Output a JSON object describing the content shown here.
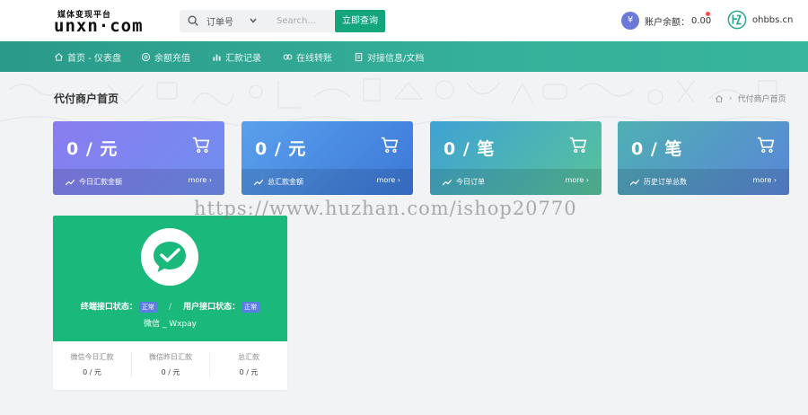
{
  "logo": {
    "sub": "媒体变现平台",
    "main": "unxn·com"
  },
  "search": {
    "select_value": "订单号",
    "placeholder": "Search...",
    "button_label": "立即查询"
  },
  "balance": {
    "icon_glyph": "¥",
    "label": "账户余额：",
    "value": "0.00"
  },
  "brand2": {
    "text": "ohbbs.cn"
  },
  "nav": {
    "items": [
      {
        "label": "首页 - 仪表盘",
        "icon": "home-icon"
      },
      {
        "label": "余额充值",
        "icon": "recharge-icon"
      },
      {
        "label": "汇款记录",
        "icon": "chart-icon"
      },
      {
        "label": "在线转账",
        "icon": "transfer-icon"
      },
      {
        "label": "对接信息/文档",
        "icon": "document-icon"
      }
    ]
  },
  "page": {
    "title": "代付商户首页"
  },
  "breadcrumb": {
    "sep": "›",
    "current": "代付商户首页"
  },
  "cards": [
    {
      "value": "0 / 元",
      "label": "今日汇款金额",
      "more": "more ›",
      "icon": "cart-icon"
    },
    {
      "value": "0 / 元",
      "label": "总汇款金额",
      "more": "more ›",
      "icon": "cart-icon"
    },
    {
      "value": "0 / 笔",
      "label": "今日订单",
      "more": "more ›",
      "icon": "cart-icon"
    },
    {
      "value": "0 / 笔",
      "label": "历史订单总数",
      "more": "more ›",
      "icon": "cart-icon"
    }
  ],
  "pay_card": {
    "terminal_status_label": "终端接口状态：",
    "terminal_status_value": "正常",
    "separator": "/",
    "user_status_label": "用户接口状态：",
    "user_status_value": "正常",
    "name": "微信 _ Wxpay",
    "stats": [
      {
        "label": "微信今日汇款",
        "value": "0 / 元"
      },
      {
        "label": "微信昨日汇款",
        "value": "0 / 元"
      },
      {
        "label": "总汇款",
        "value": "0 / 元"
      }
    ]
  },
  "watermark": {
    "text": "https://www.huzhan.com/ishop20770"
  },
  "colors": {
    "accent": "#14a57d",
    "nav_start": "#2a9a8a",
    "nav_end": "#38b59d",
    "wechat_green": "#1bb87b",
    "status_tag": "#5b7ce6"
  }
}
